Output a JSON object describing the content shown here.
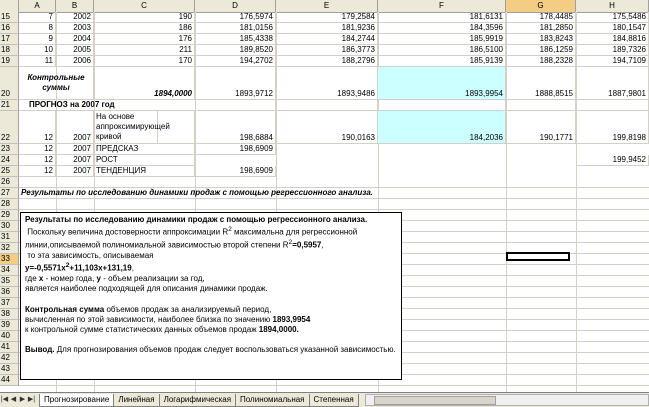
{
  "columns": [
    "A",
    "B",
    "C",
    "D",
    "E",
    "F",
    "G",
    "H"
  ],
  "selected_column": "G",
  "rows": [
    {
      "num": "15",
      "a": "7",
      "b": "2002",
      "c": "190",
      "d": "176,5974",
      "e": "179,2584",
      "f": "181,6131",
      "g": "178,4485",
      "h": "175,5486"
    },
    {
      "num": "16",
      "a": "8",
      "b": "2003",
      "c": "186",
      "d": "181,0156",
      "e": "181,9236",
      "f": "184,3596",
      "g": "181,2850",
      "h": "180,1547"
    },
    {
      "num": "17",
      "a": "9",
      "b": "2004",
      "c": "176",
      "d": "185,4338",
      "e": "184,2744",
      "f": "185,9919",
      "g": "183,8243",
      "h": "184,8816"
    },
    {
      "num": "18",
      "a": "10",
      "b": "2005",
      "c": "211",
      "d": "189,8520",
      "e": "186,3773",
      "f": "186,5100",
      "g": "186,1259",
      "h": "189,7326"
    },
    {
      "num": "19",
      "a": "11",
      "b": "2006",
      "c": "170",
      "d": "194,2702",
      "e": "188,2796",
      "f": "185,9139",
      "g": "188,2328",
      "h": "194,7109"
    }
  ],
  "row20": {
    "num": "20",
    "label": "Контрольные суммы",
    "c": "1894,0000",
    "d": "1893,9712",
    "e": "1893,9486",
    "f": "1893,9954",
    "g": "1888,8515",
    "h": "1887,9801"
  },
  "row21": {
    "num": "21",
    "label": "ПРОГНОЗ на 2007 год"
  },
  "row22": {
    "num": "22",
    "a": "12",
    "b": "2007",
    "c": "На основе аппроксимирующей кривой",
    "d": "198,6884",
    "e": "190,0163",
    "f": "184,2036",
    "g": "190,1771",
    "h": "199,8198"
  },
  "row23": {
    "num": "23",
    "a": "12",
    "b": "2007",
    "c": "ПРЕДСКАЗ",
    "d": "198,6909"
  },
  "row24": {
    "num": "24",
    "a": "12",
    "b": "2007",
    "c": "РОСТ",
    "h": "199,9452"
  },
  "row25": {
    "num": "25",
    "a": "12",
    "b": "2007",
    "c": "ТЕНДЕНЦИЯ",
    "d": "198,6909"
  },
  "row26": {
    "num": "26"
  },
  "row27": {
    "num": "27",
    "text": "Результаты по исследованию динамики продаж с помощью регрессионного анализа."
  },
  "empty_rows": [
    "28",
    "29",
    "30",
    "31",
    "32",
    "33",
    "34",
    "35",
    "36",
    "37",
    "38",
    "39",
    "40",
    "41",
    "42",
    "43",
    "44"
  ],
  "selected_row": "32",
  "textbox": {
    "title": "Результаты по исследованию динамики продаж с помощью регрессионного анализа.",
    "p1_a": "Поскольку величина достоверности аппроксимации R",
    "p1_sup": "2",
    "p1_b": " максимальна для регрессионной линии,описываемой полиномиальной зависимостью второй степени R",
    "p1_sup2": "2",
    "p1_c": "=0,5957",
    "p1_d": ",",
    "p2": "то эта зависимость, описываемая",
    "eq_a": "y=-0,5571x",
    "eq_sup": "2",
    "eq_b": "+11,103x+131,19",
    "eq_c": ",",
    "p3_a": "где ",
    "p3_x": "x",
    "p3_b": " - номер года, ",
    "p3_y": "y",
    "p3_c": " - объем реализации за год,",
    "p4": "является наиболее подходящей для описания динамики продаж.",
    "p5_a": "Контрольная сумма",
    "p5_b": " объемов продаж за анализируемый период,",
    "p6_a": "вычисленная по этой зависимости, наиболее близка по значению ",
    "p6_b": "1893,9954",
    "p7_a": "к контрольной сумме статистических данных объемов продаж ",
    "p7_b": "1894,0000.",
    "p8_a": "Вывод.",
    "p8_b": " Для прогнозирования объемов продаж следует воспользоваться указанной зависимостью."
  },
  "tabs": [
    "Прогнозирование",
    "Линейная",
    "Логарифмическая",
    "Полиномиальная",
    "Степенная"
  ],
  "active_tab": "Прогнозирование"
}
